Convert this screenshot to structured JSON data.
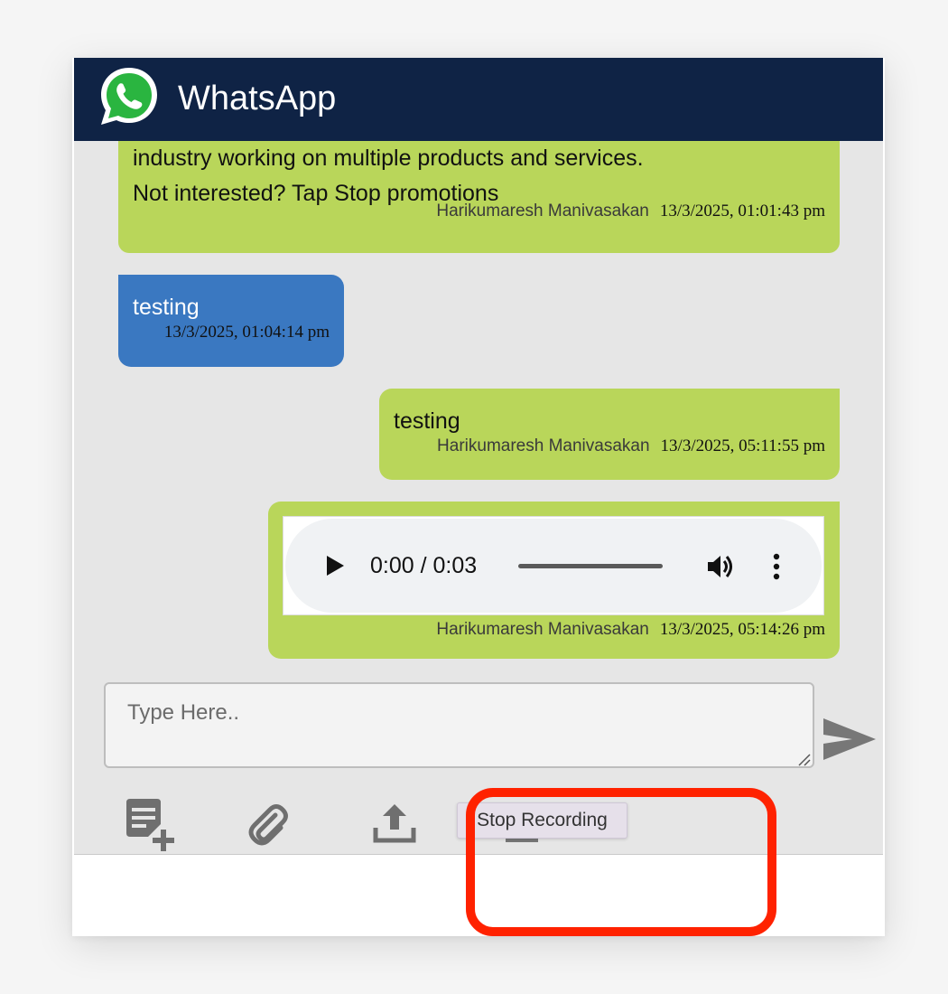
{
  "header": {
    "title": "WhatsApp"
  },
  "messages": [
    {
      "lines": [
        "industry working on multiple products and services.",
        "Not interested? Tap Stop promotions"
      ],
      "sender": "Harikumaresh Manivasakan",
      "time": "13/3/2025, 01:01:43 pm"
    },
    {
      "text": "testing",
      "time": "13/3/2025, 01:04:14 pm"
    },
    {
      "text": "testing",
      "sender": "Harikumaresh Manivasakan",
      "time": "13/3/2025, 05:11:55 pm"
    },
    {
      "audio": {
        "time_display": "0:00 / 0:03"
      },
      "sender": "Harikumaresh Manivasakan",
      "time": "13/3/2025, 05:14:26 pm"
    }
  ],
  "composer": {
    "placeholder": "Type Here.."
  },
  "toolbar": {
    "tooltip": "Stop Recording"
  },
  "colors": {
    "header_bg": "#0f2345",
    "outgoing_bubble": "#b9d65a",
    "incoming_bubble": "#3a78c1",
    "highlight": "#ff2200"
  },
  "icons": [
    "whatsapp-logo",
    "play-icon",
    "volume-icon",
    "more-vertical-icon",
    "send-icon",
    "template-add-icon",
    "attach-icon",
    "upload-icon",
    "stop-icon"
  ]
}
